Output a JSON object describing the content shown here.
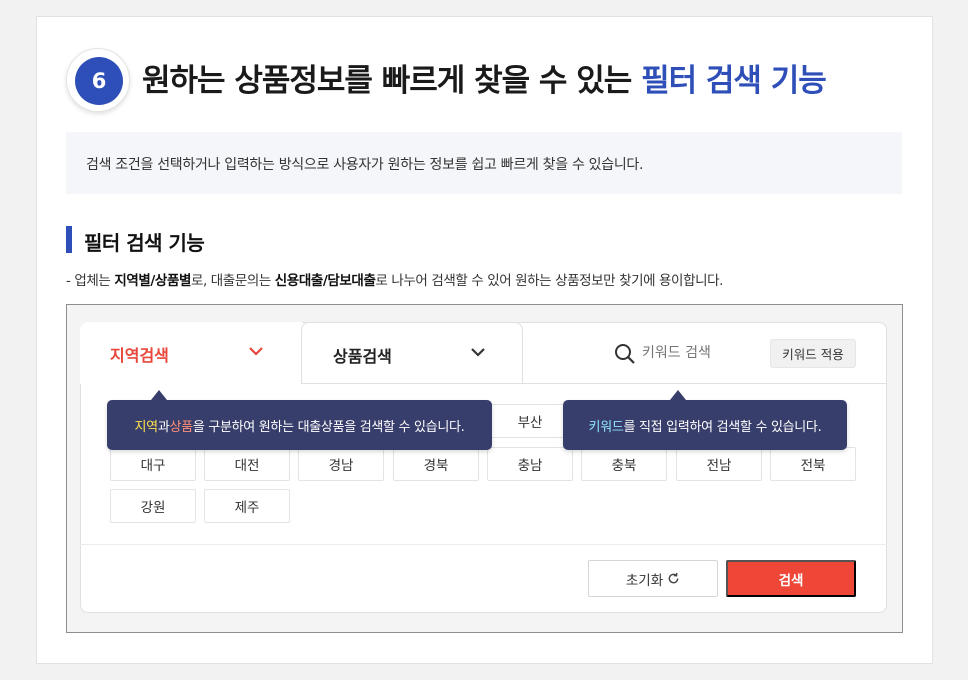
{
  "header": {
    "step_number": "6",
    "title_prefix": "원하는 상품정보를 빠르게 찾을 수 있는 ",
    "title_highlight": "필터 검색 기능"
  },
  "intro": {
    "text": "검색 조건을 선택하거나 입력하는 방식으로 사용자가 원하는 정보를 쉽고 빠르게 찾을 수 있습니다."
  },
  "section": {
    "title": "필터 검색 기능",
    "desc_1": "- 업체는 ",
    "desc_bold_1": "지역별/상품별",
    "desc_2": "로, 대출문의는 ",
    "desc_bold_2": "신용대출/담보대출",
    "desc_3": "로 나누어 검색할 수 있어 원하는 상품정보만 찾기에 용이합니다."
  },
  "filter": {
    "tab_region": "지역검색",
    "tab_product": "상품검색",
    "keyword_placeholder": "키워드 검색",
    "keyword_apply": "키워드 적용",
    "region_chips_visible": [
      "부산",
      "대구",
      "대전",
      "경남",
      "경북",
      "충남",
      "충북",
      "전남",
      "전북",
      "강원",
      "제주"
    ],
    "reset_label": "초기화",
    "search_label": "검색"
  },
  "tooltips": {
    "tip1_region": "지역",
    "tip1_and": "과 ",
    "tip1_product": "상품",
    "tip1_rest": "을 구분하여 원하는 대출상품을 검색할 수 있습니다.",
    "tip2_keyword": "키워드",
    "tip2_rest": "를 직접 입력하여 검색할 수 있습니다."
  },
  "colors": {
    "brand_blue": "#2e4fb8",
    "accent_red": "#ee4637",
    "tooltip_bg": "#383e6b"
  }
}
